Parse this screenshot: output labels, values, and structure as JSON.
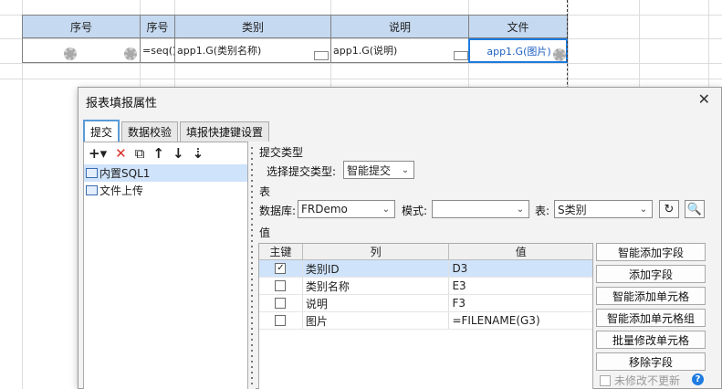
{
  "sheet": {
    "headers": [
      "序号",
      "序号",
      "类别",
      "说明",
      "文件"
    ],
    "cells": [
      "",
      "=seq()",
      "app1.G(类别名称)",
      "app1.G(说明)",
      "app1.G(图片)"
    ]
  },
  "dialog": {
    "title": "报表填报属性",
    "close": "✕",
    "tabs": [
      "提交",
      "数据校验",
      "填报快捷键设置"
    ],
    "toolbar": {
      "add": "+▾",
      "delete": "✕",
      "copy": "⧉",
      "up": "↑",
      "down": "↓",
      "sort": "⇣"
    },
    "submit_items": [
      "内置SQL1",
      "文件上传"
    ],
    "submit_type_section": "提交类型",
    "submit_type_label": "选择提交类型:",
    "submit_type_value": "智能提交",
    "table_section": "表",
    "db_label": "数据库:",
    "db_value": "FRDemo",
    "schema_label": "模式:",
    "schema_value": "",
    "table_label": "表:",
    "table_value": "S类别",
    "value_section": "值",
    "columns": {
      "key": "主键",
      "col": "列",
      "val": "值"
    },
    "rows": [
      {
        "checked": true,
        "col": "类别ID",
        "val": "D3"
      },
      {
        "checked": false,
        "col": "类别名称",
        "val": "E3"
      },
      {
        "checked": false,
        "col": "说明",
        "val": "F3"
      },
      {
        "checked": false,
        "col": "图片",
        "val": "=FILENAME(G3)"
      }
    ],
    "buttons": [
      "智能添加字段",
      "添加字段",
      "智能添加单元格",
      "智能添加单元格组",
      "批量修改单元格",
      "移除字段"
    ],
    "unchanged_option": "未修改不更新",
    "help": "?",
    "colors": {
      "accent": "#1e7be0",
      "selection": "#cfe3fb",
      "header_fill": "#c5d9f1",
      "delete_red": "#d9312b"
    }
  }
}
